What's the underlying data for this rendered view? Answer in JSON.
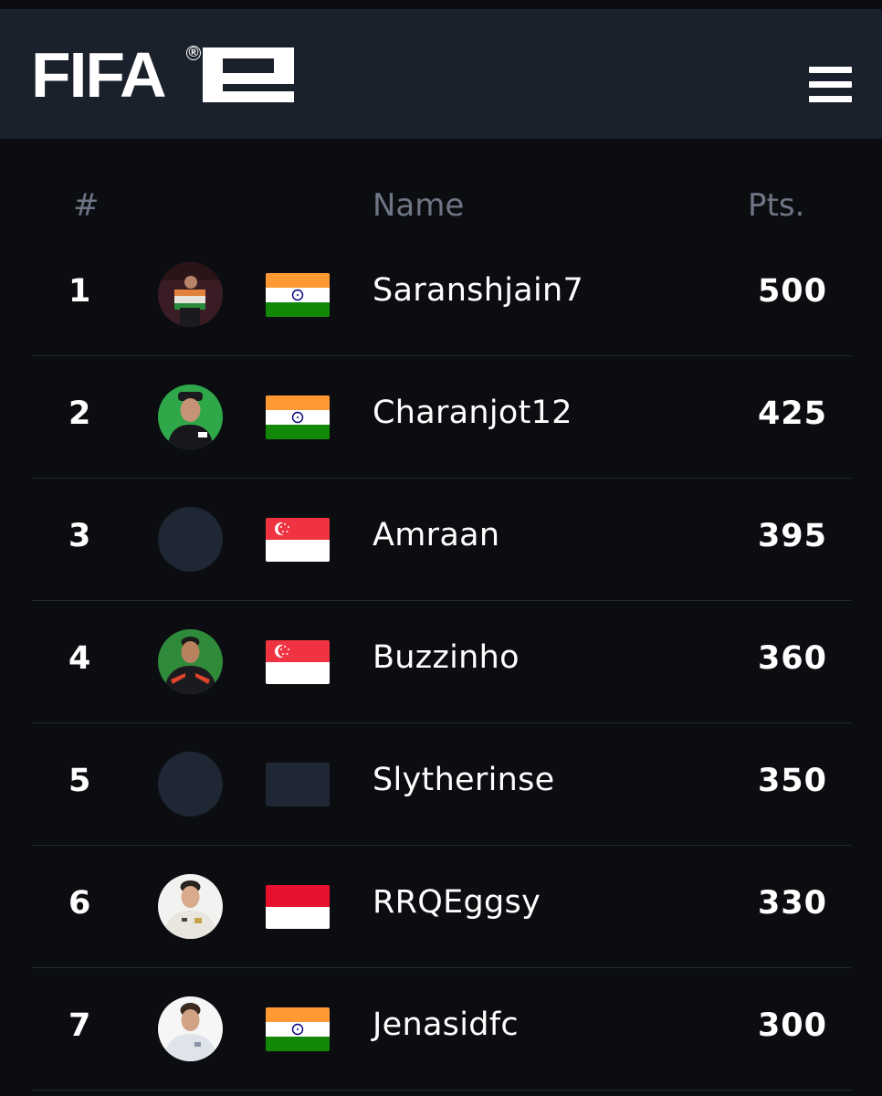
{
  "brand": {
    "logo_text": "FIFA",
    "logo_reg": "®",
    "logo_mark": "e"
  },
  "header": {
    "menu_icon": "hamburger-menu-icon",
    "background": "#1b212c"
  },
  "table": {
    "headers": {
      "rank": "#",
      "name": "Name",
      "points": "Pts."
    },
    "rows": [
      {
        "rank": "1",
        "name": "Saranshjain7",
        "points": "500",
        "flag": "India",
        "avatar": "photo"
      },
      {
        "rank": "2",
        "name": "Charanjot12",
        "points": "425",
        "flag": "India",
        "avatar": "photo"
      },
      {
        "rank": "3",
        "name": "Amraan",
        "points": "395",
        "flag": "Singapore",
        "avatar": "placeholder"
      },
      {
        "rank": "4",
        "name": "Buzzinho",
        "points": "360",
        "flag": "Singapore",
        "avatar": "photo"
      },
      {
        "rank": "5",
        "name": "Slytherinse",
        "points": "350",
        "flag": "none",
        "avatar": "placeholder"
      },
      {
        "rank": "6",
        "name": "RRQEggsy",
        "points": "330",
        "flag": "Indonesia",
        "avatar": "photo"
      },
      {
        "rank": "7",
        "name": "Jenasidfc",
        "points": "300",
        "flag": "India",
        "avatar": "photo"
      }
    ]
  },
  "colors": {
    "page_background": "#0b0d11",
    "divider": "#232a35",
    "header_text": "#6e7584",
    "placeholder": "#1f2634"
  }
}
